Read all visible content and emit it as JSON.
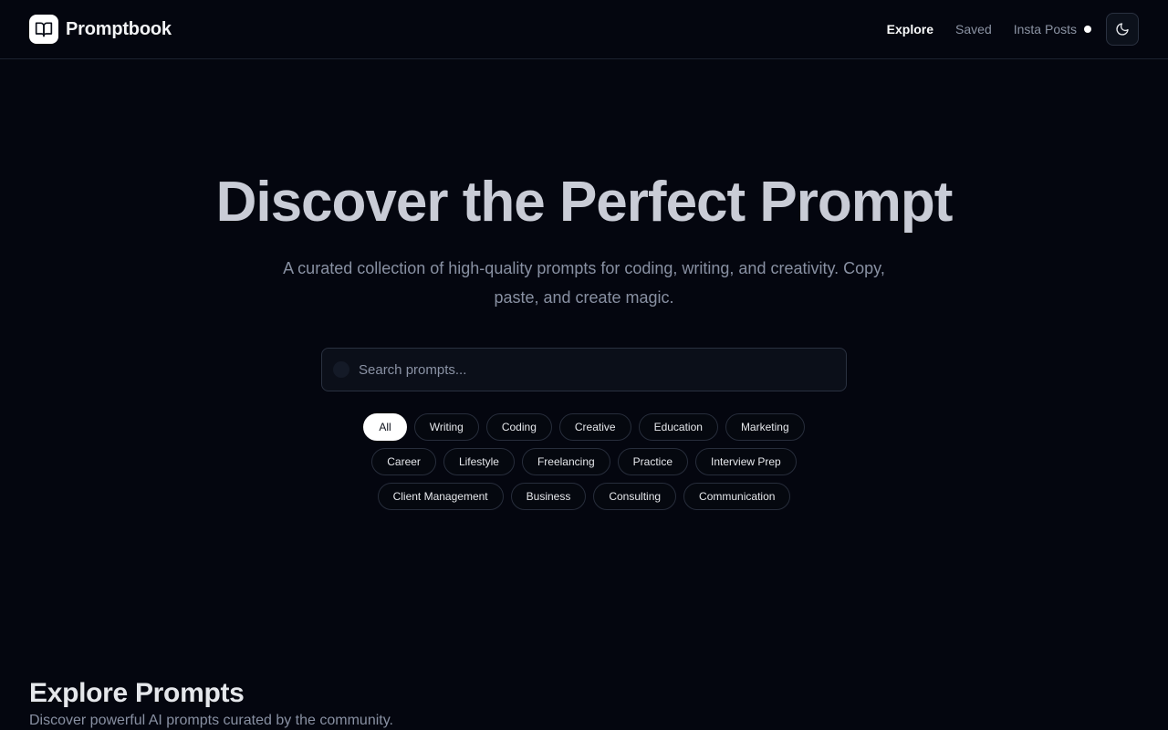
{
  "header": {
    "brand": "Promptbook",
    "nav": [
      {
        "label": "Explore",
        "active": true
      },
      {
        "label": "Saved",
        "active": false
      },
      {
        "label": "Insta Posts",
        "active": false
      }
    ],
    "theme_icon": "moon-icon"
  },
  "hero": {
    "title": "Discover the Perfect Prompt",
    "subtitle": "A curated collection of high-quality prompts for coding, writing, and creativity. Copy, paste, and create magic."
  },
  "search": {
    "placeholder": "Search prompts...",
    "value": "",
    "icon": "search-icon"
  },
  "categories": {
    "selected": "All",
    "items": [
      "All",
      "Writing",
      "Coding",
      "Creative",
      "Education",
      "Marketing",
      "Career",
      "Lifestyle",
      "Freelancing",
      "Practice",
      "Interview Prep",
      "Client Management",
      "Business",
      "Consulting",
      "Communication"
    ]
  },
  "section": {
    "title": "Explore Prompts",
    "subtitle": "Discover powerful AI prompts curated by the community."
  },
  "colors": {
    "background": "#04060f",
    "accent": "#ffffff",
    "muted_text": "#8890a2"
  }
}
